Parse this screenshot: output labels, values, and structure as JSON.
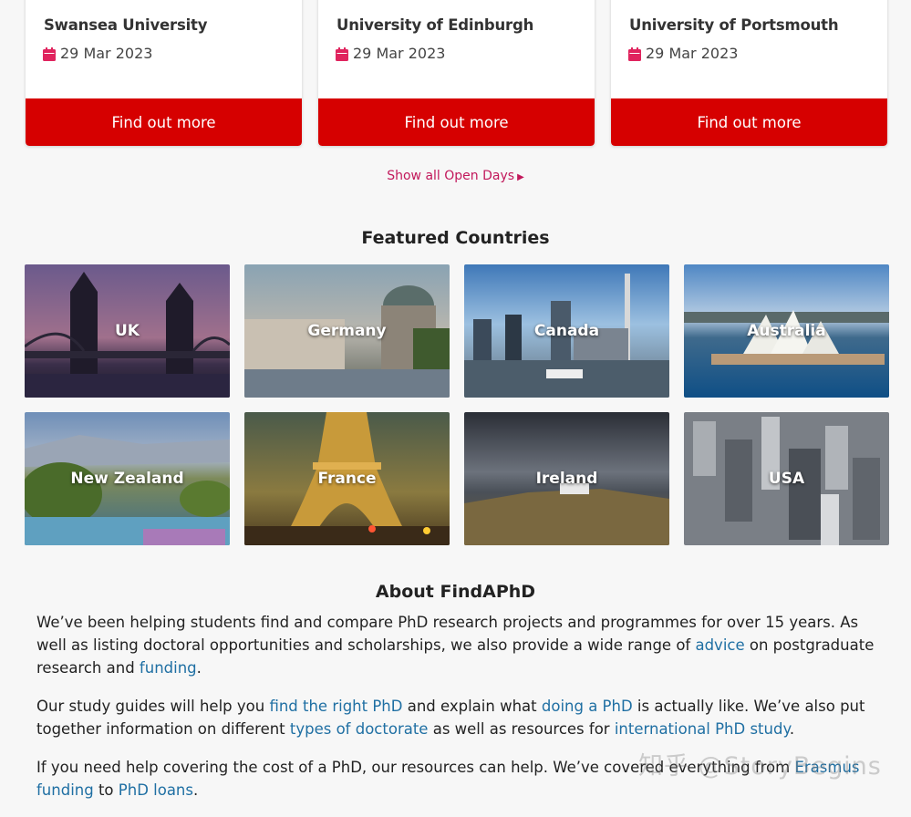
{
  "open_days": {
    "cards": [
      {
        "university": "Swansea University",
        "date": "29 Mar 2023",
        "button": "Find out more"
      },
      {
        "university": "University of Edinburgh",
        "date": "29 Mar 2023",
        "button": "Find out more"
      },
      {
        "university": "University of Portsmouth",
        "date": "29 Mar 2023",
        "button": "Find out more"
      }
    ],
    "show_all_label": "Show all Open Days"
  },
  "featured": {
    "title": "Featured Countries",
    "countries": [
      {
        "name": "UK"
      },
      {
        "name": "Germany"
      },
      {
        "name": "Canada"
      },
      {
        "name": "Australia"
      },
      {
        "name": "New Zealand"
      },
      {
        "name": "France"
      },
      {
        "name": "Ireland"
      },
      {
        "name": "USA"
      }
    ]
  },
  "about": {
    "title": "About FindAPhD",
    "p1_a": "We’ve been helping students find and compare PhD research projects and programmes for over 15 years. As well as listing doctoral opportunities and scholarships, we also provide a wide range of ",
    "p1_link1": "advice",
    "p1_b": " on postgraduate research and ",
    "p1_link2": "funding",
    "p1_c": ".",
    "p2_a": "Our study guides will help you ",
    "p2_link1": "find the right PhD",
    "p2_b": " and explain what ",
    "p2_link2": "doing a PhD",
    "p2_c": " is actually like. We’ve also put together information on different ",
    "p2_link3": "types of doctorate",
    "p2_d": " as well as resources for ",
    "p2_link4": "international PhD study",
    "p2_e": ".",
    "p3_a": "If you need help covering the cost of a PhD, our resources can help. We’ve covered everything from ",
    "p3_link1": "Erasmus funding",
    "p3_b": " to ",
    "p3_link2": "PhD loans",
    "p3_c": "."
  },
  "watermark": "知乎 @StoryBegins",
  "colors": {
    "button_red": "#d60000",
    "link_blue": "#1f6fa3",
    "accent_pink": "#c2185b"
  }
}
